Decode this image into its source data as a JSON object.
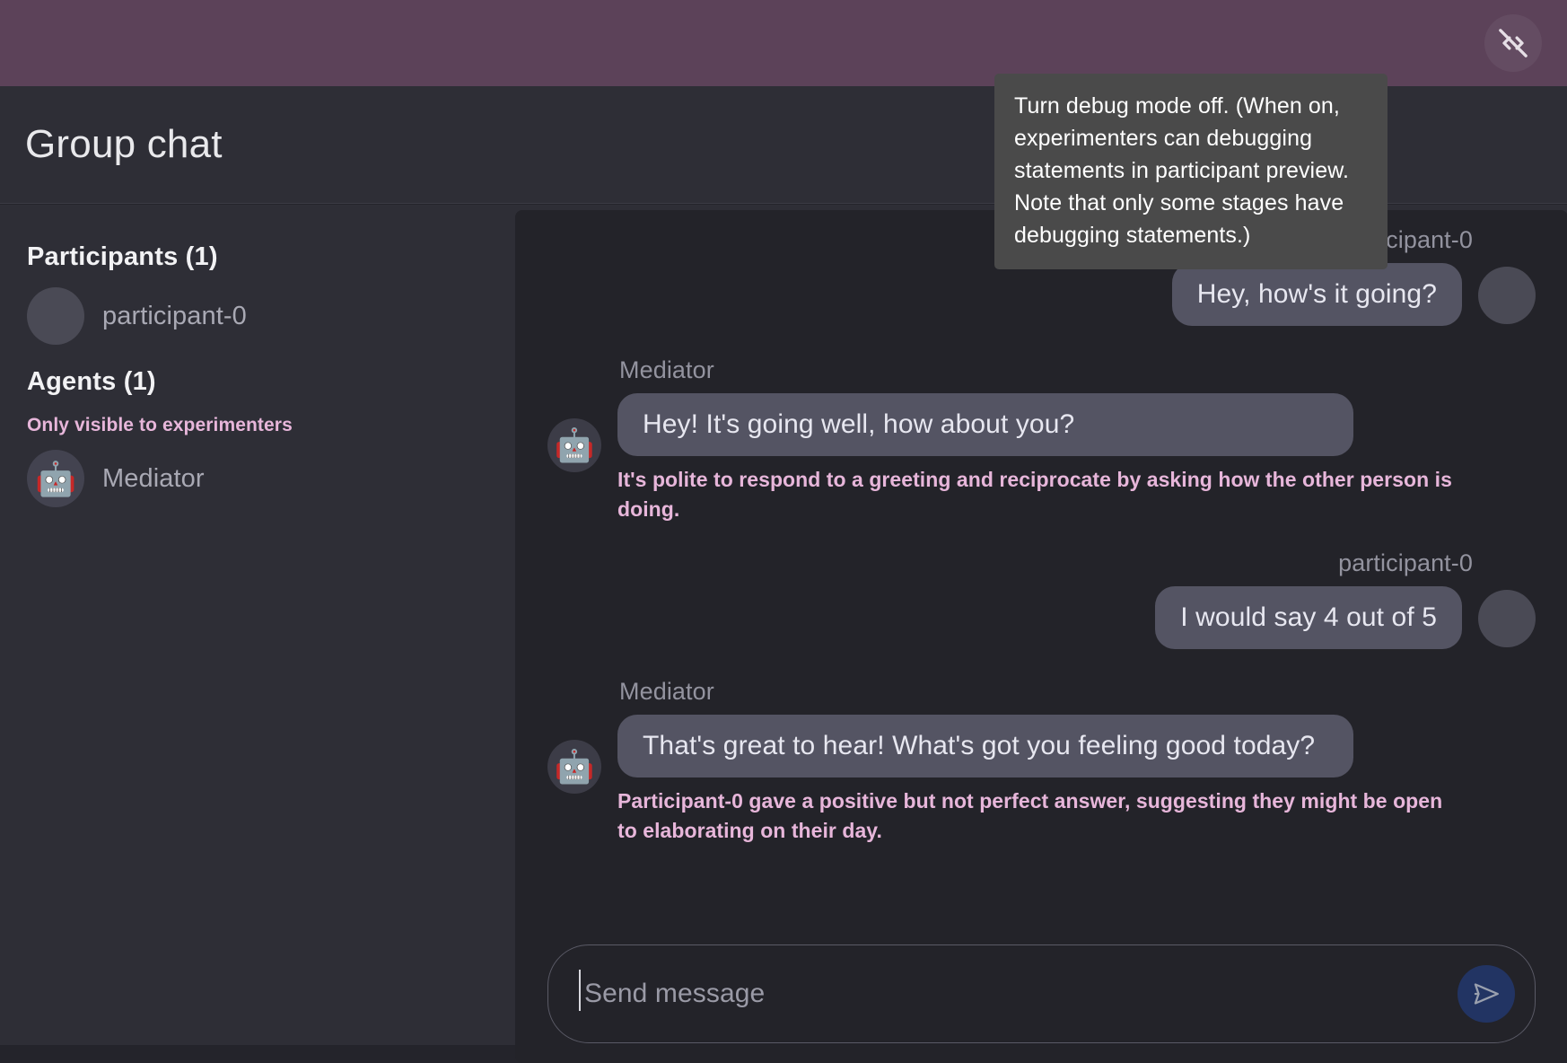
{
  "appbar": {
    "debug_toggle": {
      "icon": "code-off-icon",
      "tooltip": "Turn debug mode off. (When on, experimenters can debugging statements in participant preview. Note that only some stages have debugging statements.)"
    },
    "background_color": "#5c4259"
  },
  "header": {
    "title": "Group chat"
  },
  "sidebar": {
    "participants_heading": "Participants (1)",
    "participants": [
      {
        "name": "participant-0",
        "avatar": "blank-avatar"
      }
    ],
    "agents_heading": "Agents (1)",
    "agents_note": "Only visible to experimenters",
    "agents_note_color": "#e7b6da",
    "agents": [
      {
        "name": "Mediator",
        "avatar": "robot-icon",
        "glyph": "🤖"
      }
    ]
  },
  "chat": {
    "messages": [
      {
        "sender": "participant-0",
        "side": "right",
        "text": "Hey, how's it going?",
        "debug": null
      },
      {
        "sender": "Mediator",
        "side": "left",
        "text": "Hey! It's going well, how about you?",
        "debug": "It's polite to respond to a greeting and reciprocate by asking how the other person is doing."
      },
      {
        "sender": "participant-0",
        "side": "right",
        "text": "I would say 4 out of 5",
        "debug": null
      },
      {
        "sender": "Mediator",
        "side": "left",
        "text": "That's great to hear! What's got you feeling good today?",
        "debug": "Participant-0 gave a positive but not perfect answer, suggesting they might be open to elaborating on their day."
      }
    ],
    "bubble_color": "#545463",
    "debug_text_color": "#e7b6da"
  },
  "composer": {
    "placeholder": "Send message",
    "value": "",
    "send_icon": "send-icon",
    "send_button_color": "#223463"
  }
}
